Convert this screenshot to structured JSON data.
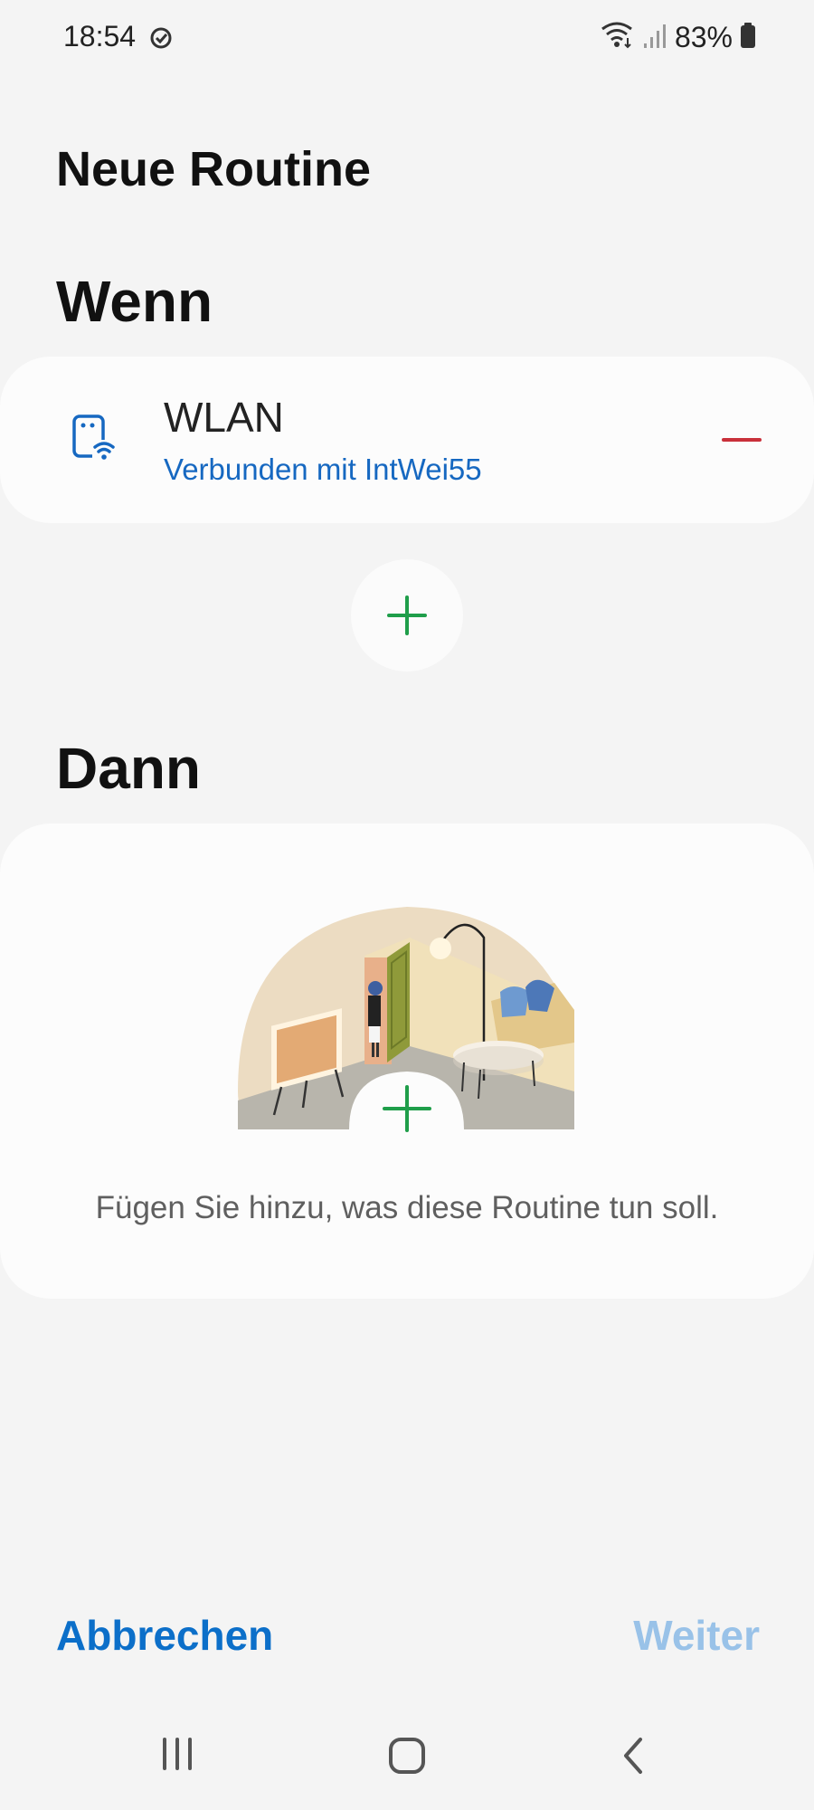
{
  "status": {
    "time": "18:54",
    "battery": "83%"
  },
  "page": {
    "title": "Neue Routine"
  },
  "wenn": {
    "heading": "Wenn",
    "condition": {
      "icon": "wifi-tablet-icon",
      "title": "WLAN",
      "subtitle": "Verbunden mit IntWei55"
    }
  },
  "dann": {
    "heading": "Dann",
    "hint": "Fügen Sie hinzu, was diese Routine tun soll."
  },
  "footer": {
    "cancel_label": "Abbrechen",
    "next_label": "Weiter"
  },
  "colors": {
    "accent": "#0c6fc9",
    "add": "#1f9e4a",
    "remove": "#c9303a",
    "disabled": "#99c2e8"
  }
}
